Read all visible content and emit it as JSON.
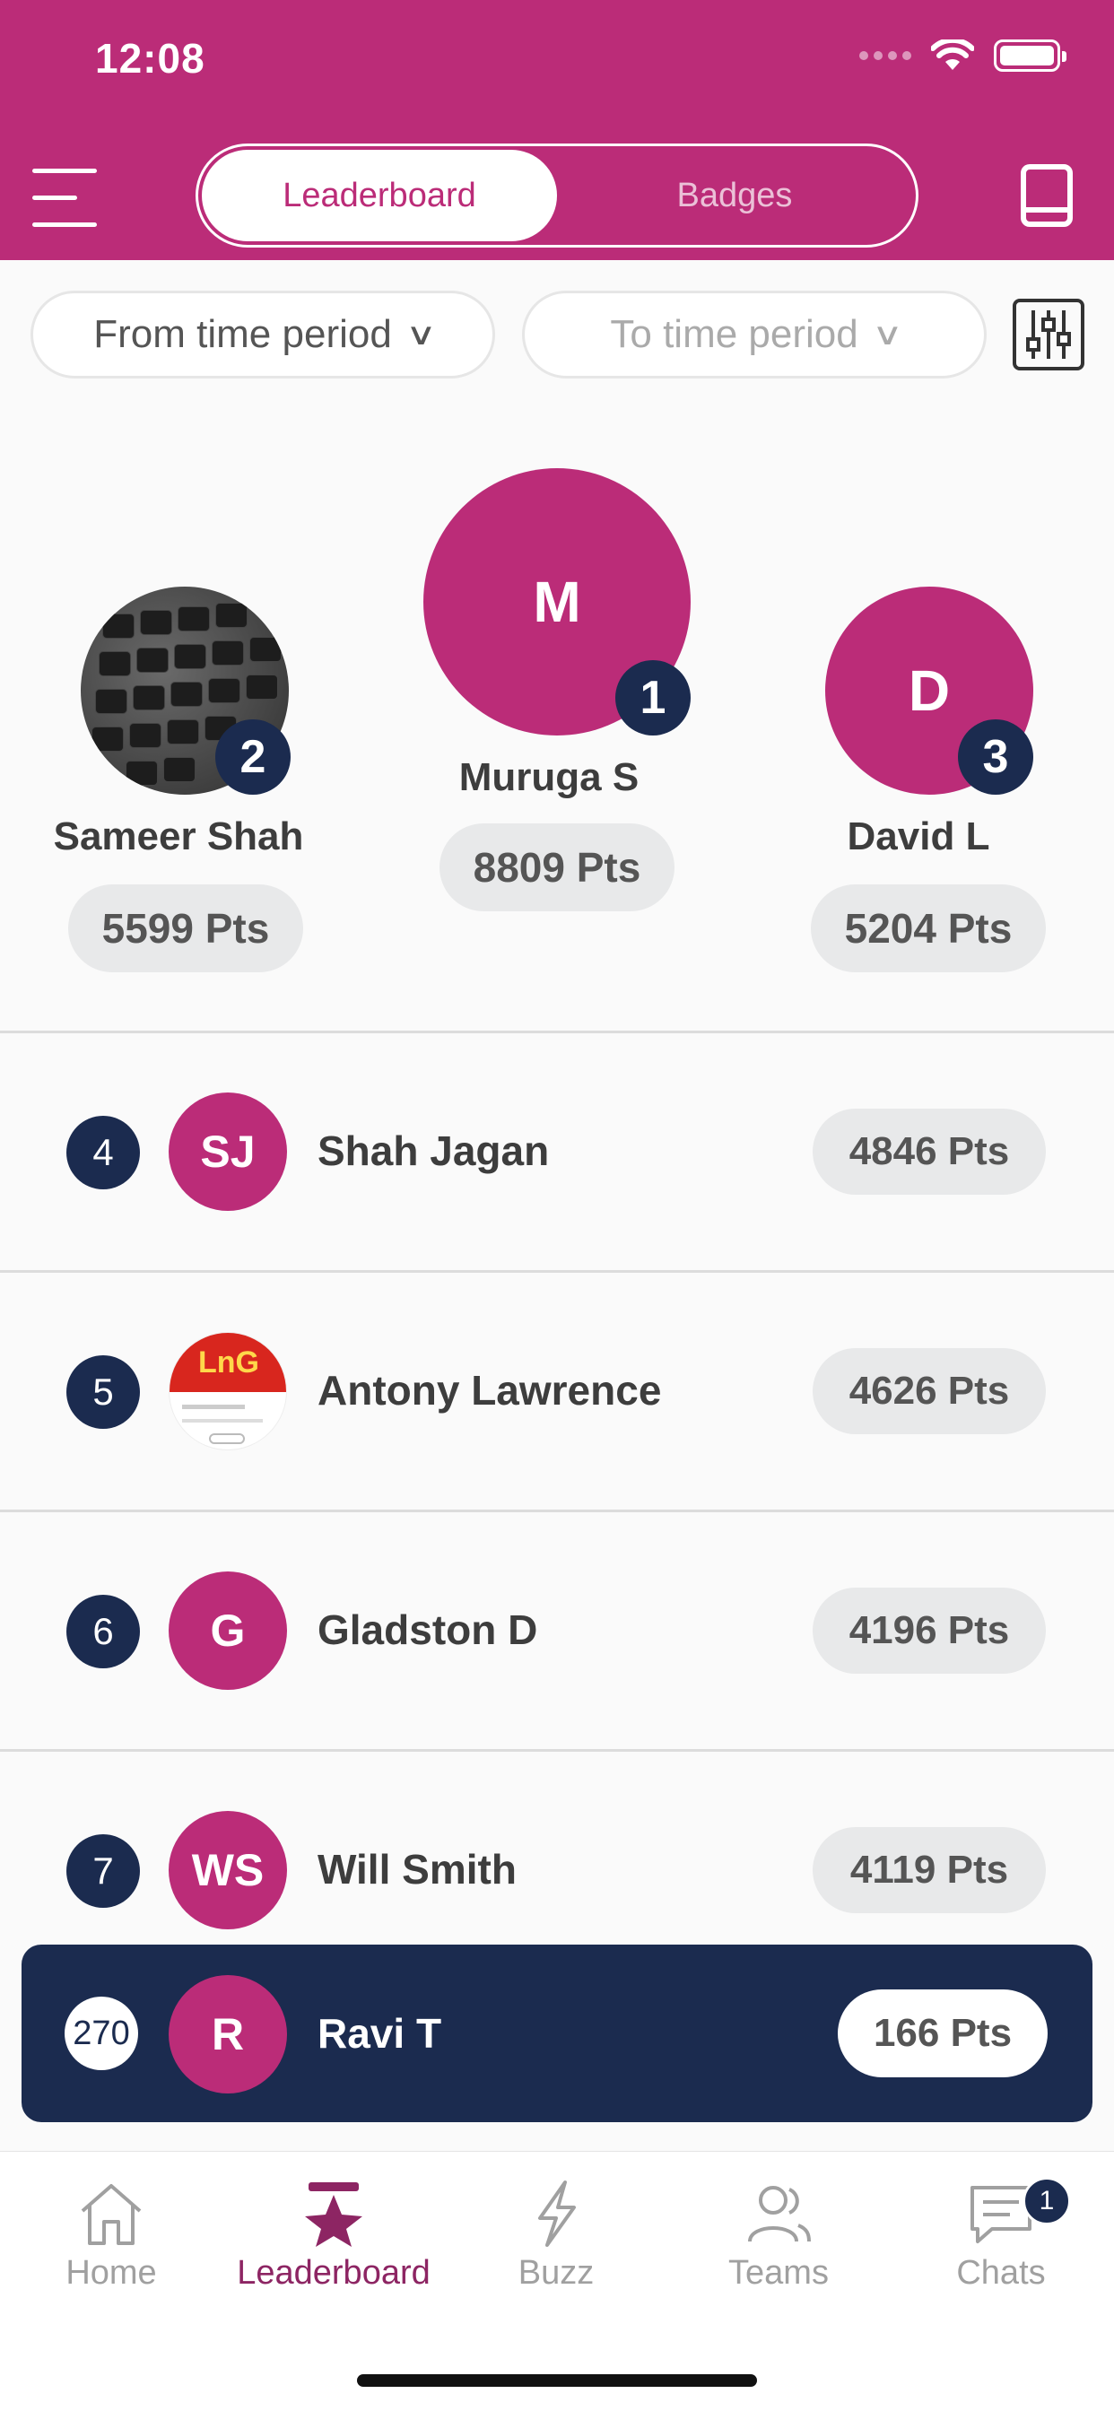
{
  "status": {
    "time": "12:08"
  },
  "header": {
    "tabs": [
      {
        "label": "Leaderboard",
        "active": true
      },
      {
        "label": "Badges",
        "active": false
      }
    ],
    "menu_icon": "hamburger-menu-icon",
    "right_icon": "book-icon"
  },
  "filters": {
    "from_label": "From time period",
    "to_label": "To time period",
    "filter_icon": "sliders-icon"
  },
  "podium": {
    "first": {
      "rank": "1",
      "initial": "M",
      "name": "Muruga S",
      "points": "8809 Pts"
    },
    "second": {
      "rank": "2",
      "name": "Sameer Shah",
      "points": "5599 Pts",
      "avatar": "keyboard-photo"
    },
    "third": {
      "rank": "3",
      "initial": "D",
      "name": "David L",
      "points": "5204 Pts"
    }
  },
  "rows": [
    {
      "rank": "4",
      "initials": "SJ",
      "name": "Shah Jagan",
      "points": "4846 Pts"
    },
    {
      "rank": "5",
      "initials": "LnG",
      "name": "Antony Lawrence",
      "points": "4626 Pts",
      "avatar": "lng-logo-photo"
    },
    {
      "rank": "6",
      "initials": "G",
      "name": "Gladston D",
      "points": "4196 Pts"
    },
    {
      "rank": "7",
      "initials": "WS",
      "name": "Will Smith",
      "points": "4119 Pts"
    }
  ],
  "current_user": {
    "rank": "270",
    "initial": "R",
    "name": "Ravi T",
    "points": "166 Pts"
  },
  "tabbar": [
    {
      "label": "Home",
      "icon": "home-icon",
      "active": false
    },
    {
      "label": "Leaderboard",
      "icon": "star-podium-icon",
      "active": true
    },
    {
      "label": "Buzz",
      "icon": "lightning-icon",
      "active": false
    },
    {
      "label": "Teams",
      "icon": "people-icon",
      "active": false
    },
    {
      "label": "Chats",
      "icon": "chat-icon",
      "active": false,
      "badge": "1"
    }
  ],
  "colors": {
    "brand": "#bb2c78",
    "navy": "#1b2b4f",
    "pill_bg": "#e8e9ea",
    "tab_active": "#8d2563",
    "tab_inactive": "#a0a0a0"
  }
}
